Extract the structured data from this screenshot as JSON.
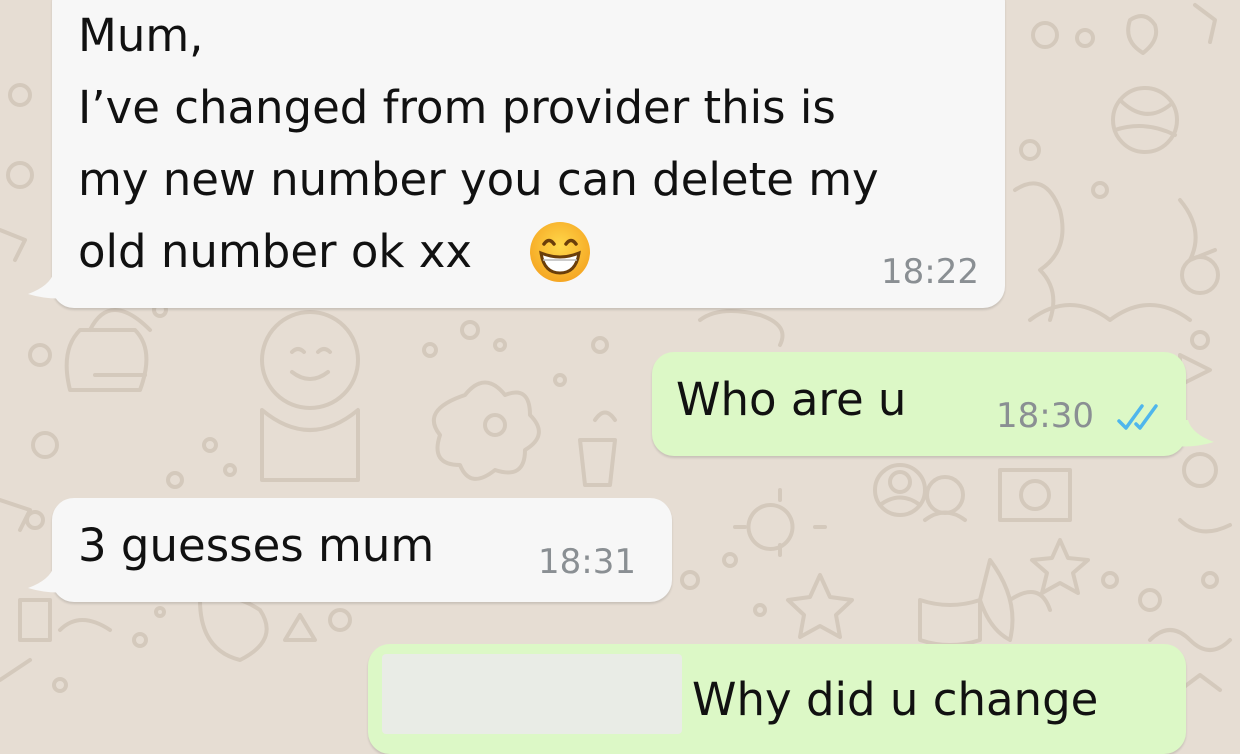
{
  "chat": {
    "messages": [
      {
        "direction": "incoming",
        "lines": [
          "Mum,",
          "I’ve changed from provider this is",
          "my new number you can delete my",
          "old number ok xx"
        ],
        "emoji": "grinning-face-with-smiling-eyes",
        "time": "18:22"
      },
      {
        "direction": "outgoing",
        "text": "Who are u",
        "time": "18:30",
        "status": "read",
        "status_color": "#4fb6ec"
      },
      {
        "direction": "incoming",
        "text": "3 guesses mum",
        "time": "18:31"
      },
      {
        "direction": "outgoing",
        "text": "Why did u change",
        "redacted_prefix": true
      }
    ]
  },
  "colors": {
    "wallpaper": "#e6ddd3",
    "incoming_bubble": "#f7f7f7",
    "outgoing_bubble": "#dcf8c6",
    "timestamp": "#8a8f93",
    "read_ticks": "#4fb6ec"
  }
}
